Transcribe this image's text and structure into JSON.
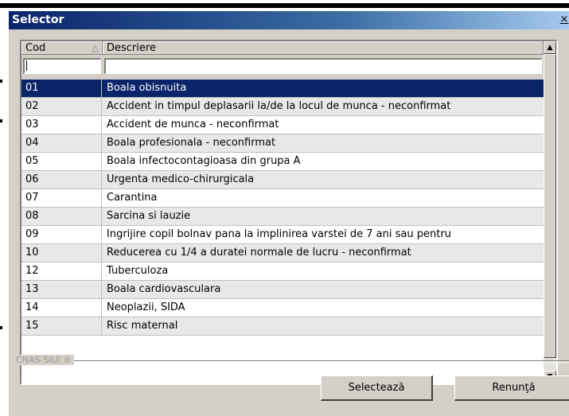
{
  "window": {
    "title": "Selector",
    "close_glyph": "×"
  },
  "grid": {
    "columns": [
      {
        "label": "Cod",
        "sort": "ascending"
      },
      {
        "label": "Descriere"
      }
    ],
    "filters": {
      "cod": "",
      "descriere": ""
    },
    "selected_index": 0,
    "rows": [
      {
        "cod": "01",
        "descriere": "Boala obisnuita"
      },
      {
        "cod": "02",
        "descriere": "Accident in timpul deplasarii la/de la locul de munca - neconfirmat"
      },
      {
        "cod": "03",
        "descriere": "Accident de munca - neconfirmat"
      },
      {
        "cod": "04",
        "descriere": "Boala profesionala - neconfirmat"
      },
      {
        "cod": "05",
        "descriere": "Boala infectocontagioasa din grupa A"
      },
      {
        "cod": "06",
        "descriere": "Urgenta medico-chirurgicala"
      },
      {
        "cod": "07",
        "descriere": "Carantina"
      },
      {
        "cod": "08",
        "descriere": "Sarcina si lauzie"
      },
      {
        "cod": "09",
        "descriere": "Ingrijire copil bolnav pana la implinirea varstei de 7 ani sau pentru"
      },
      {
        "cod": "10",
        "descriere": "Reducerea cu 1/4 a duratei normale de lucru - neconfirmat"
      },
      {
        "cod": "12",
        "descriere": "Tuberculoza"
      },
      {
        "cod": "13",
        "descriere": "Boala cardiovasculara"
      },
      {
        "cod": "14",
        "descriere": "Neoplazii, SIDA"
      },
      {
        "cod": "15",
        "descriere": "Risc maternal"
      }
    ]
  },
  "footer": {
    "brand": "CNAS-SIUI ®",
    "select_label": "Selectează",
    "cancel_label": "Renunţă"
  },
  "colors": {
    "titlebar": "#0a246a",
    "selection": "#0a246a",
    "face": "#d4d0c8"
  }
}
